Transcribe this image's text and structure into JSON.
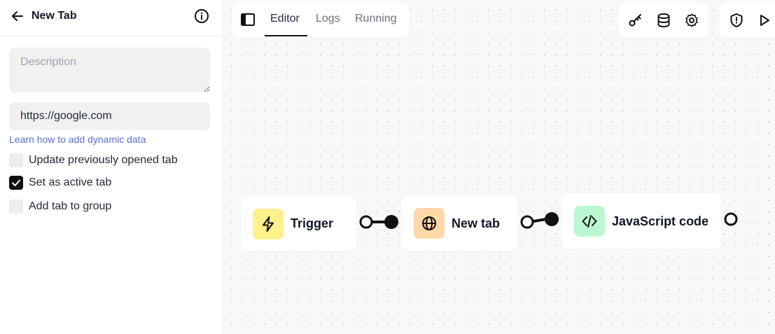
{
  "sidebar": {
    "title": "New Tab",
    "description_placeholder": "Description",
    "description_value": "",
    "url_value": "https://google.com",
    "help_link": "Learn how to add dynamic data",
    "checkboxes": [
      {
        "label": "Update previously opened tab",
        "checked": false
      },
      {
        "label": "Set as active tab",
        "checked": true
      },
      {
        "label": "Add tab to group",
        "checked": false
      }
    ]
  },
  "tabs": [
    {
      "label": "Editor",
      "active": true
    },
    {
      "label": "Logs",
      "active": false
    },
    {
      "label": "Running",
      "active": false
    }
  ],
  "toolbar": {
    "icons": [
      "key-icon",
      "database-icon",
      "gear-icon"
    ],
    "actions": [
      "shield-icon",
      "play-icon"
    ]
  },
  "nodes": [
    {
      "label": "Trigger",
      "icon": "lightning-icon",
      "icon_bg": "#fef08a"
    },
    {
      "label": "New tab",
      "icon": "globe-icon",
      "icon_bg": "#fed7aa"
    },
    {
      "label": "JavaScript code",
      "icon": "code-icon",
      "icon_bg": "#bbf7d0"
    }
  ],
  "colors": {
    "canvas_bg": "#f8f8f8",
    "link": "#5a6fd6",
    "accent": "#111111"
  }
}
